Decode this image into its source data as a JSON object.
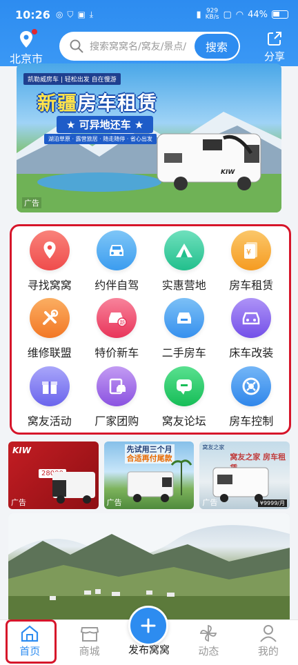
{
  "status_bar": {
    "time": "10:26",
    "net_speed_top": "929",
    "net_speed_bottom": "KB/s",
    "battery": "44%"
  },
  "header": {
    "city": "北京市",
    "search_placeholder": "搜索窝窝名/窝友/景点/",
    "search_button": "搜索",
    "share_label": "分享"
  },
  "banner": {
    "tag": "凯勒威房车 | 轻松出发 自在慢游",
    "title_part1": "新疆",
    "title_part2": "房车租赁",
    "subtitle": "★ 可异地还车 ★",
    "features": "湖泊草原 · 露营旅居 · 随走随停 · 省心出发",
    "vehicle_brand": "KIW",
    "ad_label": "广告"
  },
  "menu": {
    "items": [
      {
        "label": "寻找窝窝",
        "icon": "location-pin-icon",
        "color": "#f0524f"
      },
      {
        "label": "约伴自驾",
        "icon": "car-front-icon",
        "color": "#3fa6f2"
      },
      {
        "label": "实惠营地",
        "icon": "tent-icon",
        "color": "#2ec89a"
      },
      {
        "label": "房车租赁",
        "icon": "rental-document-icon",
        "color": "#f7a630"
      },
      {
        "label": "维修联盟",
        "icon": "tools-icon",
        "color": "#f6883a"
      },
      {
        "label": "特价新车",
        "icon": "new-car-icon",
        "color": "#ee4a6a"
      },
      {
        "label": "二手房车",
        "icon": "used-rv-icon",
        "color": "#3f9ef2"
      },
      {
        "label": "床车改装",
        "icon": "car-modify-icon",
        "color": "#8a67ee"
      },
      {
        "label": "窝友活动",
        "icon": "gift-icon",
        "color": "#7c78ef"
      },
      {
        "label": "厂家团购",
        "icon": "group-buy-icon",
        "color": "#9b6be8"
      },
      {
        "label": "窝友论坛",
        "icon": "chat-bubble-icon",
        "color": "#2ccd6c"
      },
      {
        "label": "房车控制",
        "icon": "control-dial-icon",
        "color": "#3b93ef"
      }
    ]
  },
  "ads": [
    {
      "ad_label": "广告",
      "brand": "KIW",
      "price": "28000"
    },
    {
      "ad_label": "广告",
      "title_line1": "先试用三个月",
      "title_line2": "合适再付尾款"
    },
    {
      "ad_label": "广告",
      "title_small": "窝友之家",
      "title_main": "窝友之家 房车租赁",
      "price": "¥9999/月"
    }
  ],
  "bottom_nav": {
    "items": [
      {
        "label": "首页",
        "icon": "home-icon",
        "active": true
      },
      {
        "label": "商城",
        "icon": "shop-icon"
      },
      {
        "label": "发布窝窝",
        "icon": "plus-icon"
      },
      {
        "label": "动态",
        "icon": "pinwheel-icon"
      },
      {
        "label": "我的",
        "icon": "user-icon"
      }
    ]
  },
  "colors": {
    "primary": "#2d8cf0",
    "highlight_red": "#d6152a"
  }
}
